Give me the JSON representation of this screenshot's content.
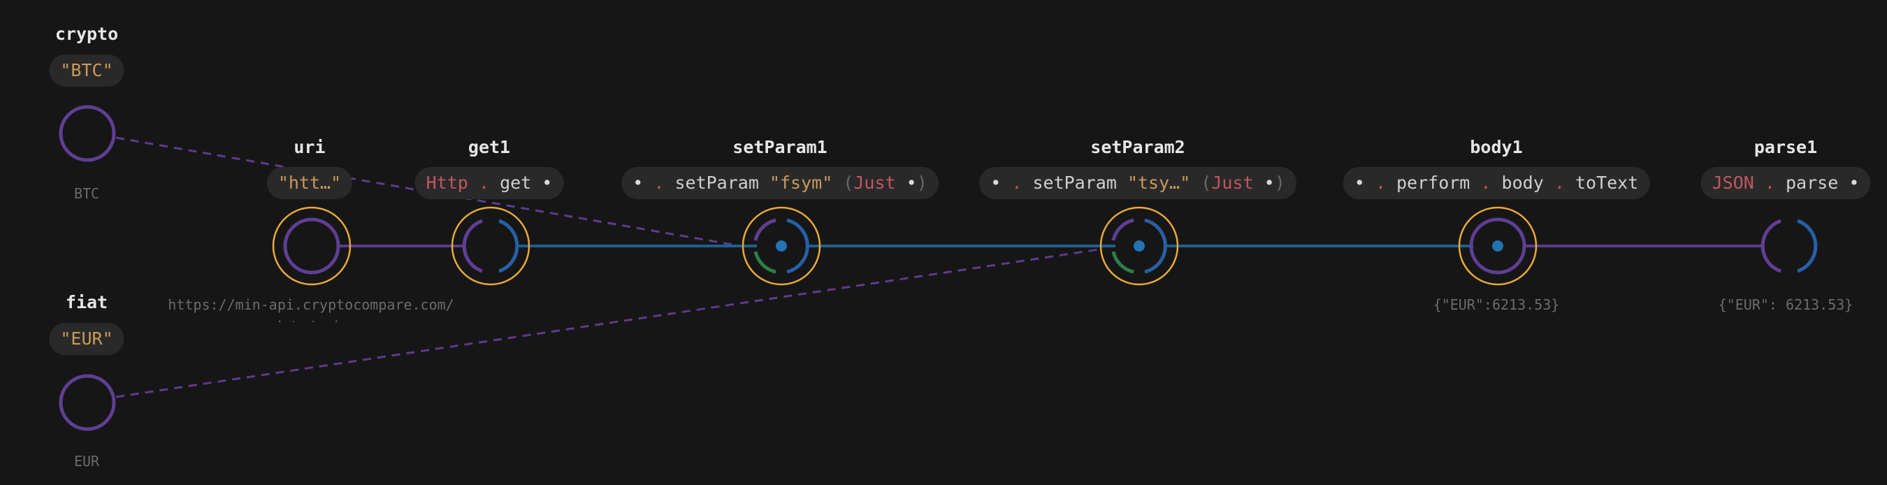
{
  "colors": {
    "background": "#171616",
    "pill": "#2a2929",
    "node_ring": "#5e3f94",
    "selection_ring": "#e8a93a",
    "flow_line": "#1f5f8c",
    "input_line": "#5a3c8f",
    "port_blue": "#2760a6",
    "port_green": "#2e7d4a",
    "string": "#c99a5b",
    "keyword": "#c25560"
  },
  "inputs": [
    {
      "name": "crypto",
      "value": "\"BTC\"",
      "result": "BTC"
    },
    {
      "name": "fiat",
      "value": "\"EUR\"",
      "result": "EUR"
    }
  ],
  "nodes": {
    "uri": {
      "name": "uri",
      "value": "\"htt…\"",
      "result": "https://min-api.cryptocompare.com/data/pric"
    },
    "get1": {
      "name": "get1",
      "ctor": "Http",
      "op": ".",
      "fn": "get",
      "hole": "•"
    },
    "setParam1": {
      "name": "setParam1",
      "hole": "•",
      "op": ".",
      "fn": "setParam",
      "str": "\"fsym\"",
      "open": "(",
      "ctor": "Just",
      "hole2": "•",
      "close": ")"
    },
    "setParam2": {
      "name": "setParam2",
      "hole": "•",
      "op": ".",
      "fn": "setParam",
      "str": "\"tsy…\"",
      "open": "(",
      "ctor": "Just",
      "hole2": "•",
      "close": ")"
    },
    "body1": {
      "name": "body1",
      "hole": "•",
      "op1": ".",
      "fn1": "perform",
      "op2": ".",
      "fn2": "body",
      "op3": ".",
      "fn3": "toText",
      "result": "{\"EUR\":6213.53}"
    },
    "parse1": {
      "name": "parse1",
      "ctor": "JSON",
      "op": ".",
      "fn": "parse",
      "hole": "•",
      "result": "{\"EUR\": 6213.53}"
    }
  }
}
